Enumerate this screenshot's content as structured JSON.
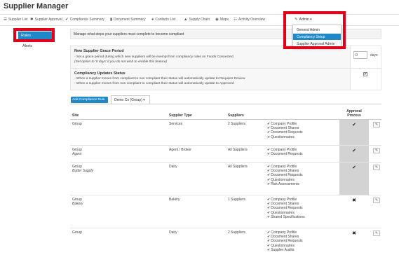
{
  "app": {
    "title": "Supplier Manager"
  },
  "nav": [
    {
      "icon": "☰",
      "icon_name": "list-icon",
      "label": "Supplier List"
    },
    {
      "icon": "✱",
      "icon_name": "gear-icon",
      "label": "Supplier Approval"
    },
    {
      "icon": "✔",
      "icon_name": "check-icon",
      "label": "Compliance Summary"
    },
    {
      "icon": "▮",
      "icon_name": "document-icon",
      "label": "Document Summary"
    },
    {
      "icon": "●",
      "icon_name": "user-icon",
      "label": "Contacts List"
    },
    {
      "icon": "▲",
      "icon_name": "sitemap-icon",
      "label": "Supply Chain"
    },
    {
      "icon": "◉",
      "icon_name": "globe-icon",
      "label": "Maps"
    },
    {
      "icon": "☷",
      "icon_name": "calendar-icon",
      "label": "Activity Overview"
    },
    {
      "icon": "✎",
      "icon_name": "wrench-icon",
      "label": "Admin ▾"
    }
  ],
  "admin_menu": [
    "General Admin",
    "Compliancy Setup",
    "Supplier Approval Admin"
  ],
  "sidebar": {
    "rules": "Rules",
    "alerts": "Alerts"
  },
  "intro": "Manage what steps your suppliers must complete to become compliant",
  "grace": {
    "title": "New Supplier Grace Period",
    "line1": "- Set a grace period during which new suppliers will be exempt from compliancy rules on Foods Connected.",
    "line2": "(Set option to '0 days' if you do not wish to enable this feature)",
    "value": "0",
    "unit": "days"
  },
  "updates": {
    "title": "Compliancy Updates Status",
    "line1": "- When a supplier moves from compliant to non compliant their status will automatically update to Requires Review",
    "line2": "- When a supplier moves from non compliant to compliant their status will automatically update to Approved",
    "checked": "✔"
  },
  "actions": {
    "add_rule": "Add Compliance Rule",
    "group_tab": "Demo Co (Group) ▾"
  },
  "table": {
    "headers": {
      "site": "Site",
      "type": "Supplier Type",
      "suppliers": "Suppliers",
      "requirements": "",
      "approval": "Approval Process"
    },
    "rows": [
      {
        "site": "Group",
        "sub": "",
        "type": "Services",
        "suppliers": "2 Suppliers",
        "reqs": [
          "Company Profile",
          "Document Shares",
          "Document Requests",
          "Questionnaires"
        ],
        "approval": "✔",
        "approval_state": "on"
      },
      {
        "site": "Group",
        "sub": "Agent",
        "type": "Agent / Broker",
        "suppliers": "All Suppliers",
        "reqs": [
          "Company Profile",
          "Document Requests"
        ],
        "approval": "✔",
        "approval_state": "on"
      },
      {
        "site": "Group",
        "sub": "Butter Supply",
        "type": "Dairy",
        "suppliers": "All Suppliers",
        "reqs": [
          "Company Profile",
          "Document Shares",
          "Document Requests",
          "Questionnaires",
          "Risk Assessments"
        ],
        "approval": "✔",
        "approval_state": "on"
      },
      {
        "site": "Group",
        "sub": "Bakery",
        "type": "Bakery",
        "suppliers": "1 Suppliers",
        "reqs": [
          "Company Profile",
          "Document Shares",
          "Document Requests",
          "Questionnaires",
          "Shared Specifications"
        ],
        "approval": "✖",
        "approval_state": "off"
      },
      {
        "site": "Group",
        "sub": "",
        "type": "Dairy",
        "suppliers": "2 Suppliers",
        "reqs": [
          "Company Profile",
          "Document Shares",
          "Document Requests",
          "Questionnaires",
          "Supplier Audits"
        ],
        "approval": "✖",
        "approval_state": "off"
      }
    ]
  },
  "icons": {
    "edit": "✎",
    "check": "✔"
  },
  "colors": {
    "accent": "#1e88c9",
    "highlight": "#e3001b",
    "approval_bg": "#d3d3d3"
  }
}
